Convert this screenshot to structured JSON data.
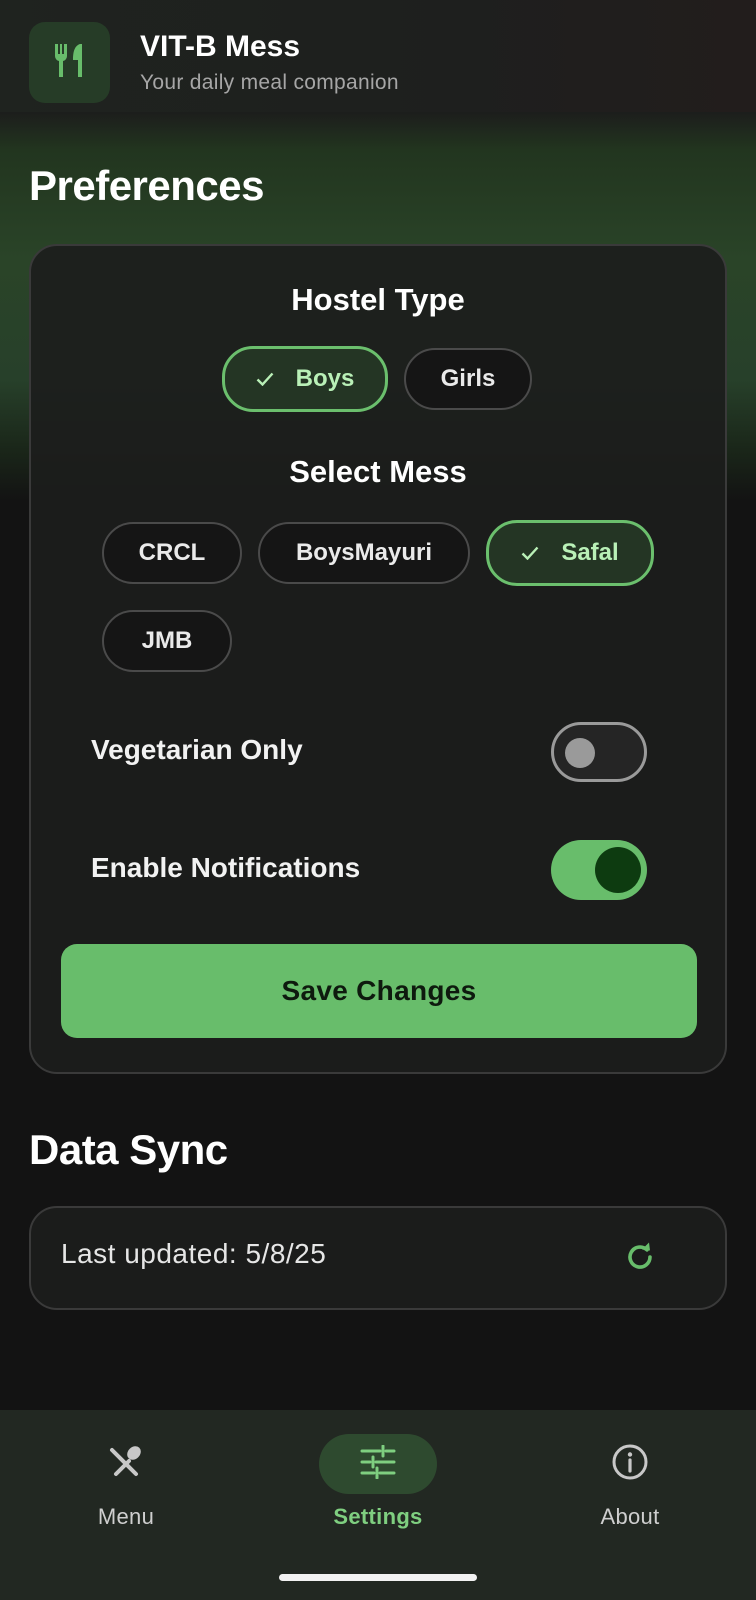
{
  "header": {
    "title": "VIT-B Mess",
    "subtitle": "Your daily meal companion",
    "logo_icon": "utensils-icon"
  },
  "preferences": {
    "title": "Preferences",
    "hostel_type": {
      "title": "Hostel Type",
      "options": [
        "Boys",
        "Girls"
      ],
      "selected": "Boys"
    },
    "mess": {
      "title": "Select Mess",
      "options": [
        "CRCL",
        "BoysMayuri",
        "Safal",
        "JMB"
      ],
      "selected": "Safal"
    },
    "vegetarian": {
      "label": "Vegetarian Only",
      "enabled": false
    },
    "notifications": {
      "label": "Enable Notifications",
      "enabled": true
    },
    "save_label": "Save Changes"
  },
  "data_sync": {
    "title": "Data Sync",
    "last_updated": "Last updated: 5/8/25",
    "refresh_icon": "refresh-icon"
  },
  "nav": {
    "items": [
      {
        "label": "Menu",
        "icon": "utensils-crossed-icon",
        "active": false
      },
      {
        "label": "Settings",
        "icon": "sliders-icon",
        "active": true
      },
      {
        "label": "About",
        "icon": "info-icon",
        "active": false
      }
    ]
  },
  "colors": {
    "accent": "#68bd6b",
    "background": "#131313",
    "card": "#1c1d1c"
  }
}
